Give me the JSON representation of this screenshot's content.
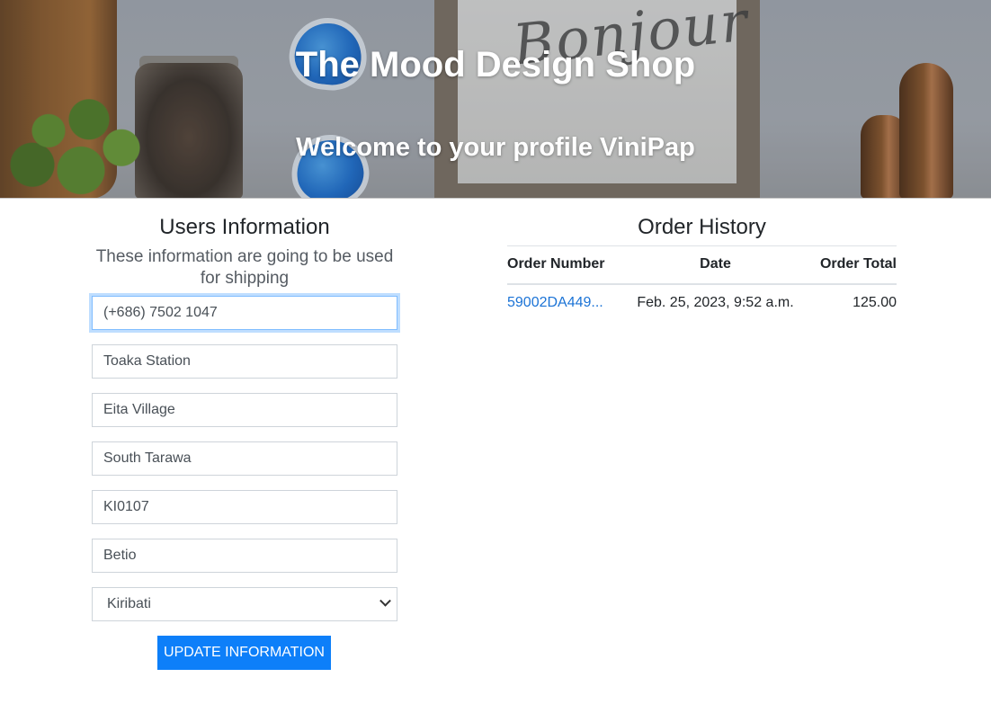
{
  "header": {
    "shop_title": "The Mood Design Shop",
    "welcome": "Welcome to your profile ViniPap",
    "banner_script": "Bonjour"
  },
  "users_info": {
    "title": "Users Information",
    "description": "These information are going to be used for shipping",
    "fields": {
      "phone": "(+686) 7502 1047",
      "street_address_1": "Toaka Station",
      "street_address_2": "Eita Village",
      "town_or_city": "South Tarawa",
      "postcode": "KI0107",
      "county": "Betio",
      "country": "Kiribati"
    },
    "update_button": "UPDATE INFORMATION"
  },
  "order_history": {
    "title": "Order History",
    "columns": [
      "Order Number",
      "Date",
      "Order Total"
    ],
    "rows": [
      {
        "order_number": "59002DA449...",
        "date": "Feb. 25, 2023, 9:52 a.m.",
        "total": "125.00"
      }
    ]
  },
  "colors": {
    "primary_button": "#0d7ff9",
    "link": "#1b73d6",
    "focus_ring": "#80bdff"
  }
}
